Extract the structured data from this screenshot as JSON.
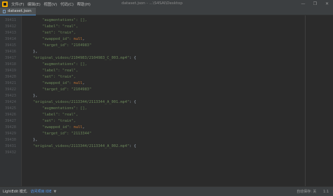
{
  "titlebar": {
    "menu": [
      "文件(F)",
      "编辑(E)",
      "视图(V)",
      "代码(C)",
      "帮助(H)"
    ],
    "window_title": "dataset.json - ...\\S4SAI\\Desktop",
    "controls": [
      "—",
      "❐",
      "✕"
    ]
  },
  "tab": {
    "label": "dataset.json"
  },
  "editor": {
    "lines": [
      {
        "num": "39411",
        "indent": 2,
        "tokens": [
          {
            "t": "\"augmentations\": [],",
            "c": "s"
          }
        ]
      },
      {
        "num": "39412",
        "indent": 2,
        "tokens": [
          {
            "t": "\"label\": \"real\",",
            "c": "s"
          }
        ]
      },
      {
        "num": "39413",
        "indent": 2,
        "tokens": [
          {
            "t": "\"set\": \"train\",",
            "c": "s"
          }
        ]
      },
      {
        "num": "39414",
        "indent": 2,
        "tokens": [
          {
            "t": "\"swapped_id\": ",
            "c": "s"
          },
          {
            "t": "null",
            "c": "k"
          },
          {
            "t": ",",
            "c": "p"
          }
        ]
      },
      {
        "num": "39415",
        "indent": 2,
        "tokens": [
          {
            "t": "\"target_id\": \"2104983\"",
            "c": "s"
          }
        ]
      },
      {
        "num": "39416",
        "indent": 1,
        "tokens": [
          {
            "t": "},",
            "c": "p"
          }
        ]
      },
      {
        "num": "39417",
        "indent": 1,
        "tokens": [
          {
            "t": "\"original_videos/2104983/2104983_C_003.mp4\"",
            "c": "s"
          },
          {
            "t": ": {",
            "c": "p"
          }
        ]
      },
      {
        "num": "39418",
        "indent": 2,
        "tokens": [
          {
            "t": "\"augmentations\": [],",
            "c": "s"
          }
        ]
      },
      {
        "num": "39419",
        "indent": 2,
        "tokens": [
          {
            "t": "\"label\": \"real\",",
            "c": "s"
          }
        ]
      },
      {
        "num": "39420",
        "indent": 2,
        "tokens": [
          {
            "t": "\"set\": \"train\",",
            "c": "s"
          }
        ]
      },
      {
        "num": "39421",
        "indent": 2,
        "tokens": [
          {
            "t": "\"swapped_id\": ",
            "c": "s"
          },
          {
            "t": "null",
            "c": "k"
          },
          {
            "t": ",",
            "c": "p"
          }
        ]
      },
      {
        "num": "39422",
        "indent": 2,
        "tokens": [
          {
            "t": "\"target_id\": \"2104983\"",
            "c": "s"
          }
        ]
      },
      {
        "num": "39423",
        "indent": 1,
        "tokens": [
          {
            "t": "},",
            "c": "p"
          }
        ]
      },
      {
        "num": "39424",
        "indent": 1,
        "tokens": [
          {
            "t": "\"original_videos/2113344/2113344_A_001.mp4\"",
            "c": "s"
          },
          {
            "t": ": {",
            "c": "p"
          }
        ]
      },
      {
        "num": "39425",
        "indent": 2,
        "tokens": [
          {
            "t": "\"augmentations\": [],",
            "c": "s"
          }
        ]
      },
      {
        "num": "39426",
        "indent": 2,
        "tokens": [
          {
            "t": "\"label\": \"real\",",
            "c": "s"
          }
        ]
      },
      {
        "num": "39427",
        "indent": 2,
        "tokens": [
          {
            "t": "\"set\": \"train\",",
            "c": "s"
          }
        ]
      },
      {
        "num": "39428",
        "indent": 2,
        "tokens": [
          {
            "t": "\"swapped_id\": ",
            "c": "s"
          },
          {
            "t": "null",
            "c": "k"
          },
          {
            "t": ",",
            "c": "p"
          }
        ]
      },
      {
        "num": "39429",
        "indent": 2,
        "tokens": [
          {
            "t": "\"target_id\": \"2113344\"",
            "c": "s"
          }
        ]
      },
      {
        "num": "39430",
        "indent": 1,
        "tokens": [
          {
            "t": "},",
            "c": "p"
          }
        ]
      },
      {
        "num": "39431",
        "indent": 1,
        "tokens": [
          {
            "t": "\"original_videos/2113344/2113344_A_002.mp4\"",
            "c": "s"
          },
          {
            "t": ": {",
            "c": "p"
          }
        ]
      },
      {
        "num": "39432",
        "indent": 0,
        "tokens": []
      }
    ]
  },
  "status": {
    "mode": "LightEdit 模式.",
    "link": "访问项目 IDE",
    "hint": "▼",
    "right": [
      "自动保存: 关",
      "1:1"
    ]
  },
  "colors": {
    "string": "#6a8759",
    "keyword": "#cc7832",
    "plain": "#a9b7c6",
    "accent": "#4a88c7"
  }
}
